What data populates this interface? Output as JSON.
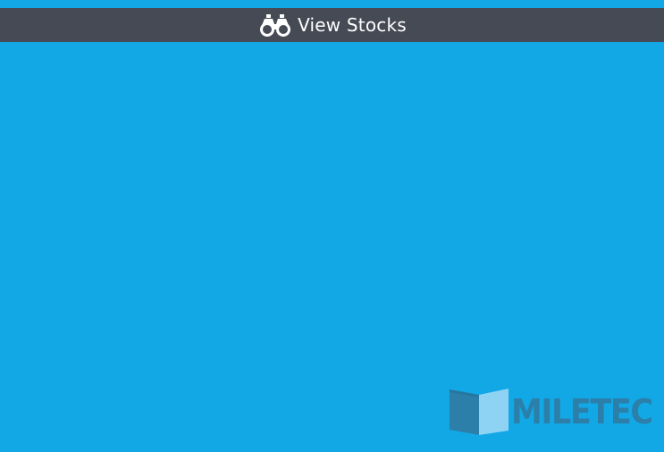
{
  "header": {
    "icon": "binoculars-icon",
    "title": "View Stocks"
  },
  "logo": {
    "text": "MILETEC"
  },
  "colors": {
    "background": "#12a8e6",
    "header": "#464a55",
    "header_text": "#ffffff",
    "logo_dark": "#2b7fa9",
    "logo_light": "#8fd3f4"
  }
}
